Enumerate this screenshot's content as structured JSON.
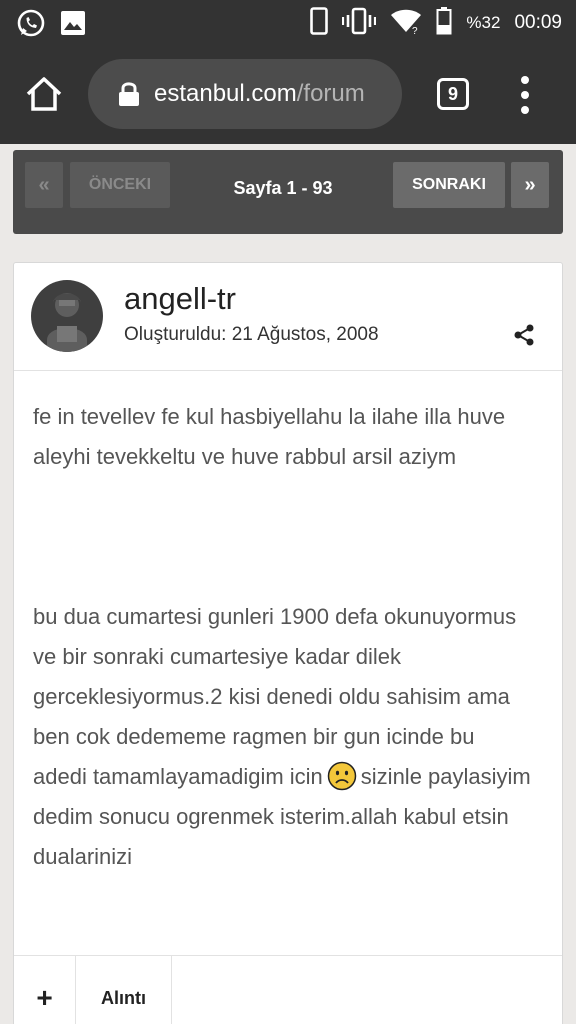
{
  "status_bar": {
    "battery_pct": "%32",
    "time": "00:09",
    "icons": [
      "whatsapp-icon",
      "gallery-icon",
      "phone-icon",
      "vibrate-icon",
      "wifi-icon",
      "battery-icon"
    ]
  },
  "browser": {
    "url_domain": "estanbul.com",
    "url_path": "/forum",
    "tab_count": "9",
    "icons": [
      "home-icon",
      "lock-icon",
      "menu-icon"
    ]
  },
  "pagination": {
    "first": "«",
    "prev": "ÖNCEKI",
    "label": "Sayfa 1 - 93",
    "next": "SONRAKI",
    "last": "»"
  },
  "post": {
    "author": "angell-tr",
    "created": "Oluşturuldu: 21 Ağustos, 2008",
    "paragraph1": "fe in tevellev fe kul hasbiyellahu la ilahe illa huve aleyhi tevekkeltu ve huve rabbul arsil aziym",
    "paragraph2_before": "bu dua cumartesi gunleri 1900 defa okunuyormus ve bir sonraki cumartesiye kadar dilek gerceklesiyormus.2 kisi denedi oldu sahisim ama ben cok dedememe ragmen bir gun icinde bu adedi tamamlayamadigim icin",
    "paragraph2_after": "sizinle paylasiyim dedim sonucu ogrenmek isterim.allah kabul etsin dualarinizi",
    "emoji": "sad-face-emoji"
  },
  "footer": {
    "plus": "+",
    "quote": "Alıntı"
  }
}
